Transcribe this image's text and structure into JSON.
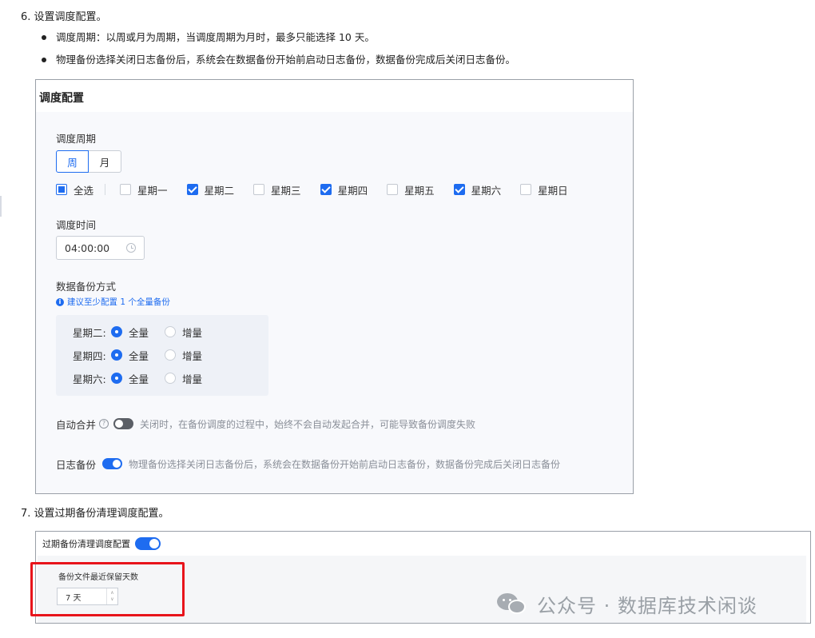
{
  "steps": {
    "step6": "6. 设置调度配置。",
    "step6_bullets": [
      "调度周期：以周或月为周期，当调度周期为月时，最多只能选择 10 天。",
      "物理备份选择关闭日志备份后，系统会在数据备份开始前启动日志备份，数据备份完成后关闭日志备份。"
    ],
    "step7": "7. 设置过期备份清理调度配置。"
  },
  "schedule": {
    "title": "调度配置",
    "period_label": "调度周期",
    "period_options": [
      "周",
      "月"
    ],
    "period_selected": "周",
    "select_all": "全选",
    "days": [
      {
        "label": "星期一",
        "checked": false
      },
      {
        "label": "星期二",
        "checked": true
      },
      {
        "label": "星期三",
        "checked": false
      },
      {
        "label": "星期四",
        "checked": true
      },
      {
        "label": "星期五",
        "checked": false
      },
      {
        "label": "星期六",
        "checked": true
      },
      {
        "label": "星期日",
        "checked": false
      }
    ],
    "time_label": "调度时间",
    "time_value": "04:00:00",
    "backup_mode_label": "数据备份方式",
    "backup_hint": "建议至少配置 1 个全量备份",
    "backup_rows": [
      {
        "day": "星期二:",
        "full": "全量",
        "incr": "增量",
        "selected": "全量"
      },
      {
        "day": "星期四:",
        "full": "全量",
        "incr": "增量",
        "selected": "全量"
      },
      {
        "day": "星期六:",
        "full": "全量",
        "incr": "增量",
        "selected": "全量"
      }
    ],
    "auto_merge_label": "自动合并",
    "auto_merge_on": false,
    "auto_merge_desc": "关闭时，在备份调度的过程中，始终不会自动发起合并，可能导致备份调度失败",
    "log_backup_label": "日志备份",
    "log_backup_on": true,
    "log_backup_desc": "物理备份选择关闭日志备份后，系统会在数据备份开始前启动日志备份，数据备份完成后关闭日志备份"
  },
  "cleanup": {
    "title": "过期备份清理调度配置",
    "enabled": true,
    "retain_label": "备份文件最近保留天数",
    "retain_value": "7 天"
  },
  "watermark": {
    "text": "公众号 · 数据库技术闲谈"
  },
  "colors": {
    "accent": "#1e6cf0",
    "highlight": "#e8141b"
  }
}
